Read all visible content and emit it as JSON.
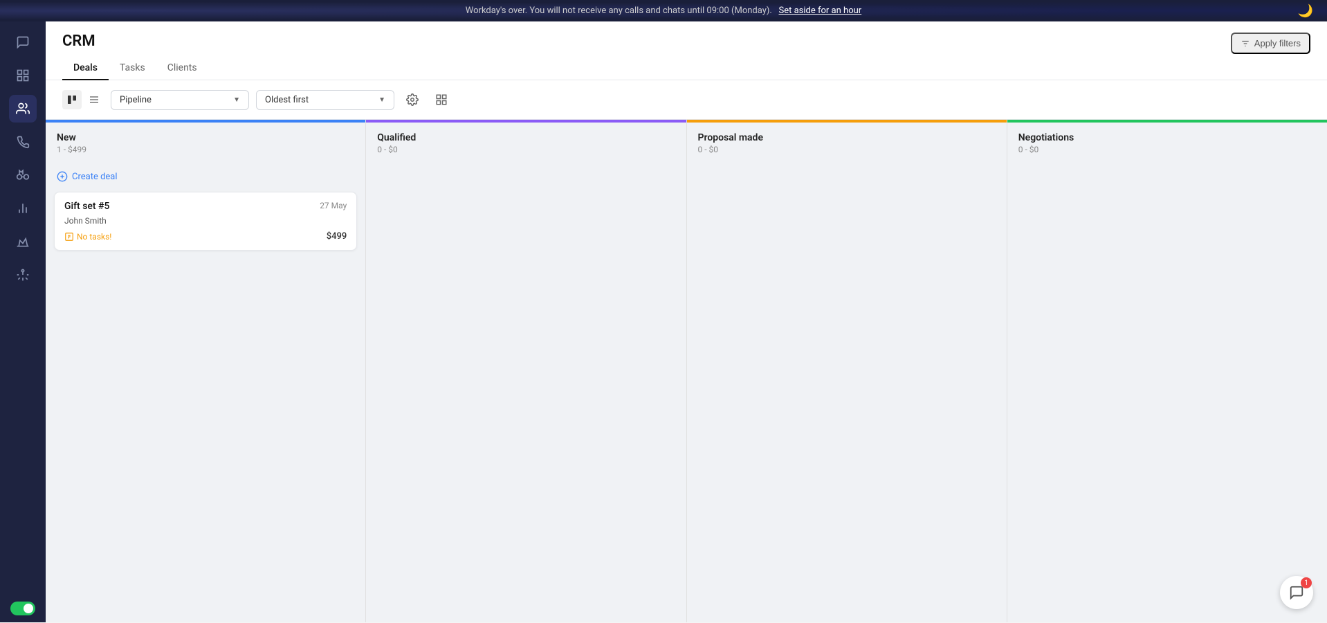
{
  "topbar": {
    "message": "Workday's over. You will not receive any calls and chats until 09:00 (Monday).",
    "link_text": "Set aside for an hour",
    "moon": "🌙"
  },
  "sidebar": {
    "icons": [
      {
        "name": "chat-icon",
        "symbol": "💬"
      },
      {
        "name": "contact-icon",
        "symbol": "👤"
      },
      {
        "name": "team-icon",
        "symbol": "👥"
      },
      {
        "name": "phone-icon",
        "symbol": "📞"
      },
      {
        "name": "binoculars-icon",
        "symbol": "🔭"
      },
      {
        "name": "chart-icon",
        "symbol": "📊"
      },
      {
        "name": "crown-icon",
        "symbol": "👑"
      },
      {
        "name": "settings-icon",
        "symbol": "⚙"
      }
    ]
  },
  "page": {
    "title": "CRM",
    "tabs": [
      {
        "id": "deals",
        "label": "Deals",
        "active": true
      },
      {
        "id": "tasks",
        "label": "Tasks",
        "active": false
      },
      {
        "id": "clients",
        "label": "Clients",
        "active": false
      }
    ]
  },
  "toolbar": {
    "view_kanban_label": "kanban",
    "view_list_label": "list",
    "pipeline_label": "Pipeline",
    "sort_label": "Oldest first",
    "apply_filters_label": "Apply filters",
    "settings_icon": "⚙",
    "chart_icon": "▦"
  },
  "columns": [
    {
      "id": "new",
      "title": "New",
      "count": "1 - $499",
      "color": "#3b82f6",
      "deals": [
        {
          "name": "Gift set #5",
          "date": "27 May",
          "person": "John Smith",
          "task_label": "No tasks!",
          "amount": "$499"
        }
      ]
    },
    {
      "id": "qualified",
      "title": "Qualified",
      "count": "0 - $0",
      "color": "#8b5cf6",
      "deals": []
    },
    {
      "id": "proposal",
      "title": "Proposal made",
      "count": "0 - $0",
      "color": "#f59e0b",
      "deals": []
    },
    {
      "id": "negotiations",
      "title": "Negotiations",
      "count": "0 - $0",
      "color": "#22c55e",
      "deals": []
    }
  ],
  "create_deal": {
    "label": "Create deal"
  },
  "chat": {
    "notification_count": "1"
  }
}
